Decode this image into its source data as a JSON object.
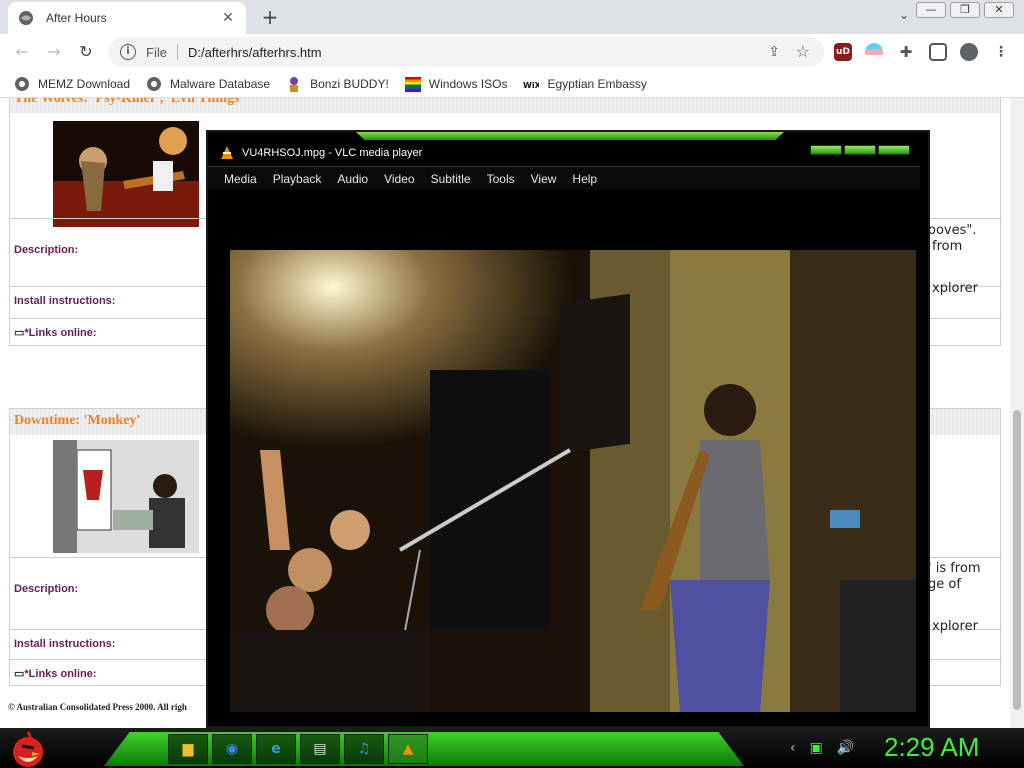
{
  "browser": {
    "tab_title": "After Hours",
    "address_scheme": "File",
    "address_url": "D:/afterhrs/afterhrs.htm",
    "bookmarks": [
      {
        "label": "MEMZ Download",
        "icon": "globe-icon"
      },
      {
        "label": "Malware Database",
        "icon": "globe-icon"
      },
      {
        "label": "Bonzi BUDDY!",
        "icon": "bonzi-icon"
      },
      {
        "label": "Windows ISOs",
        "icon": "windows-flag-icon"
      },
      {
        "label": "Egyptian Embassy",
        "icon": "wix-icon"
      }
    ],
    "extensions": [
      {
        "name": "ublock-icon",
        "label": "uD",
        "color": "#8b1a1a"
      },
      {
        "name": "pride-flag-icon",
        "label": "",
        "color": "#f5a9b8"
      },
      {
        "name": "puzzle-icon",
        "label": "",
        "color": "#555555"
      }
    ]
  },
  "page": {
    "card1": {
      "heading": "The Wolves: 'Psy-Killer', 'Evil Things'",
      "description_label": "Description:",
      "description_text_1": "ooves\".",
      "description_text_2": "from",
      "install_label": "Install instructions:",
      "install_text": "xplorer",
      "links_label": "*Links online:"
    },
    "card2": {
      "heading": "Downtime: 'Monkey'",
      "description_label": "Description:",
      "description_text_1": "' is from",
      "description_text_2": "ge of",
      "install_label": "Install instructions:",
      "install_text": "xplorer",
      "links_label": "*Links online:"
    },
    "copyright": "© Australian Consolidated Press 2000. All righ"
  },
  "vlc": {
    "title": "VU4RHSOJ.mpg - VLC media player",
    "menu": [
      "Media",
      "Playback",
      "Audio",
      "Video",
      "Subtitle",
      "Tools",
      "View",
      "Help"
    ]
  },
  "taskbar": {
    "clock": "2:29 AM",
    "apps": [
      {
        "name": "file-explorer-icon",
        "glyph": "📁"
      },
      {
        "name": "chrome-icon",
        "glyph": "◉"
      },
      {
        "name": "internet-explorer-icon",
        "glyph": "e"
      },
      {
        "name": "computer-icon",
        "glyph": "🖥"
      },
      {
        "name": "media-icon",
        "glyph": "♪"
      },
      {
        "name": "vlc-icon",
        "glyph": "▲"
      }
    ]
  }
}
